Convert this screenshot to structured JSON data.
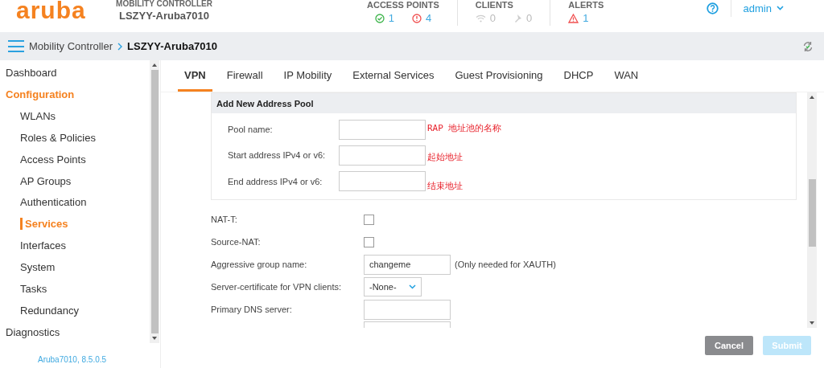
{
  "header": {
    "logo": "aruba",
    "subtitle": "MOBILITY CONTROLLER",
    "device": "LSZYY-Aruba7010",
    "stats": [
      {
        "title": "ACCESS POINTS",
        "items": [
          {
            "kind": "ok",
            "value": "1",
            "disabled": false
          },
          {
            "kind": "error",
            "value": "4",
            "disabled": false
          }
        ]
      },
      {
        "title": "CLIENTS",
        "items": [
          {
            "kind": "wireless",
            "value": "0",
            "disabled": true
          },
          {
            "kind": "wired",
            "value": "0",
            "disabled": true
          }
        ]
      },
      {
        "title": "ALERTS",
        "items": [
          {
            "kind": "alert",
            "value": "1",
            "disabled": false
          }
        ]
      }
    ],
    "user": "admin"
  },
  "breadcrumb": {
    "parent": "Mobility Controller",
    "current": "LSZYY-Aruba7010"
  },
  "sidebar": {
    "items": [
      {
        "label": "Dashboard",
        "selected": false
      },
      {
        "label": "Configuration",
        "selected": true,
        "expanded": true,
        "children": [
          {
            "label": "WLANs",
            "selected": false
          },
          {
            "label": "Roles & Policies",
            "selected": false
          },
          {
            "label": "Access Points",
            "selected": false
          },
          {
            "label": "AP Groups",
            "selected": false
          },
          {
            "label": "Authentication",
            "selected": false
          },
          {
            "label": "Services",
            "selected": true
          },
          {
            "label": "Interfaces",
            "selected": false
          },
          {
            "label": "System",
            "selected": false
          },
          {
            "label": "Tasks",
            "selected": false
          },
          {
            "label": "Redundancy",
            "selected": false
          }
        ]
      },
      {
        "label": "Diagnostics",
        "selected": false
      }
    ],
    "version": "Aruba7010, 8.5.0.5"
  },
  "tabs": [
    {
      "label": "VPN",
      "selected": true
    },
    {
      "label": "Firewall",
      "selected": false
    },
    {
      "label": "IP Mobility",
      "selected": false
    },
    {
      "label": "External Services",
      "selected": false
    },
    {
      "label": "Guest Provisioning",
      "selected": false
    },
    {
      "label": "DHCP",
      "selected": false
    },
    {
      "label": "WAN",
      "selected": false
    }
  ],
  "pool": {
    "title": "Add New Address Pool",
    "fields": [
      {
        "label": "Pool name:",
        "note": "RAP 地址池的名称"
      },
      {
        "label": "Start address IPv4 or v6:",
        "note": "起始地址"
      },
      {
        "label": "End address IPv4 or v6:",
        "note": "结束地址"
      }
    ]
  },
  "settings": [
    {
      "kind": "checkbox",
      "label": "NAT-T:",
      "checked": false
    },
    {
      "kind": "checkbox",
      "label": "Source-NAT:",
      "checked": false
    },
    {
      "kind": "input",
      "label": "Aggressive group name:",
      "value": "changeme",
      "hint": "(Only needed for XAUTH)"
    },
    {
      "kind": "select",
      "label": "Server-certificate for VPN clients:",
      "value": "-None-"
    },
    {
      "kind": "input",
      "label": "Primary DNS server:"
    },
    {
      "kind": "input"
    }
  ],
  "buttons": [
    {
      "label": "Cancel",
      "disabled": false
    },
    {
      "label": "Submit",
      "disabled": true
    }
  ]
}
